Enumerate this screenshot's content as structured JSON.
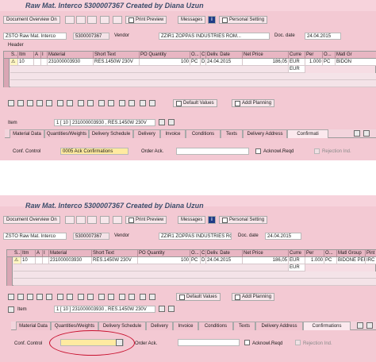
{
  "panel1": {
    "title": "Raw Mat. Interco 5300007367 Created by Diana Uzun",
    "toolbar": {
      "doc_overview": "Document Overview On",
      "print_preview": "Print Preview",
      "messages": "Messages",
      "personal_setting": "Personal Setting"
    },
    "doc_type": "ZSTO Raw Mat. Interco",
    "doc_number": "5300007367",
    "vendor_label": "Vendor",
    "vendor_value": "ZZIR1 ZOPPAS INDUSTRIES ROM...",
    "doc_date_label": "Doc. date",
    "doc_date_value": "24.04.2015",
    "header_label": "Header",
    "columns": [
      "S..",
      "Itm",
      "A",
      "I",
      "Material",
      "Short Text",
      "PO Quantity",
      "O...",
      "C",
      "Deliv. Date",
      "Net Price",
      "Curre",
      "Per",
      "O...",
      "Matl Gr"
    ],
    "row": {
      "itm": "10",
      "material": "231000003930",
      "short_text": "RES.1450W 230V",
      "po_quantity": "100",
      "oun": "PC",
      "c": "D",
      "deliv_date": "24.04.2015",
      "net_price": "186,05",
      "currency": "EUR",
      "per": "1.000",
      "opu": "PC",
      "matl_group": "BIDON"
    },
    "row2_currency": "EUR",
    "buttons": {
      "default_values": "Default Values",
      "addl_planning": "Addl Planning"
    },
    "item_label": "Item",
    "item_value": "1 [ 10 ] 231000003930 , RES.1450W 230V",
    "tabs": [
      "Material Data",
      "Quantities/Weights",
      "Delivery Schedule",
      "Delivery",
      "Invoice",
      "Conditions",
      "Texts",
      "Delivery Address",
      "Confirmati"
    ],
    "conf_control_label": "Conf. Control",
    "conf_control_value": "0005 Ack Confirmations",
    "order_ack_label": "Order Ack.",
    "acknowl_label": "Acknowl.Reqd",
    "rejection_label": "Rejection Ind."
  },
  "panel2": {
    "title": "Raw Mat. Interco 5300007367 Created by Diana Uzun",
    "toolbar": {
      "doc_overview": "Document Overview On",
      "print_preview": "Print Preview",
      "messages": "Messages",
      "personal_setting": "Personal Setting"
    },
    "doc_type": "ZSTO Raw Mat. Interco",
    "doc_number": "5300007367",
    "vendor_label": "Vendor",
    "vendor_value": "ZZIR1 ZOPPAS INDUSTRIES ROM...",
    "doc_date_label": "Doc. date",
    "doc_date_value": "24.04.2015",
    "columns": [
      "S..",
      "Itm",
      "A",
      "I",
      "Material",
      "Short Text",
      "PO Quantity",
      "O...",
      "C",
      "Deliv. Date",
      "Net Price",
      "Curre",
      "Per",
      "O...",
      "Matl Group",
      "Pint"
    ],
    "row": {
      "itm": "10",
      "material": "231000003930",
      "short_text": "RES.1450W 230V",
      "po_quantity": "100",
      "oun": "PC",
      "c": "D",
      "deliv_date": "24.04.2015",
      "net_price": "186,05",
      "currency": "EUR",
      "per": "1.000",
      "opu": "PC",
      "matl_group": "BIDONE PER",
      "plant": "IRC"
    },
    "row2_currency": "EUR",
    "buttons": {
      "default_values": "Default Values",
      "addl_planning": "Addl Planning"
    },
    "item_label": "Item",
    "item_value": "1 [ 10 ] 231000003930 , RES.1450W 230V",
    "tabs": [
      "Material Data",
      "Quantities/Weights",
      "Delivery Schedule",
      "Delivery",
      "Invoice",
      "Conditions",
      "Texts",
      "Delivery Address",
      "Confirmations"
    ],
    "conf_control_label": "Conf. Control",
    "conf_control_value": "",
    "order_ack_label": "Order Ack.",
    "acknowl_label": "Acknowl.Reqd",
    "rejection_label": "Rejection Ind."
  },
  "colors": {
    "background": "#f3c9d3",
    "title": "#3c4d6b",
    "highlight": "#ffeaa0",
    "annotation_circle": "#c8102e"
  }
}
